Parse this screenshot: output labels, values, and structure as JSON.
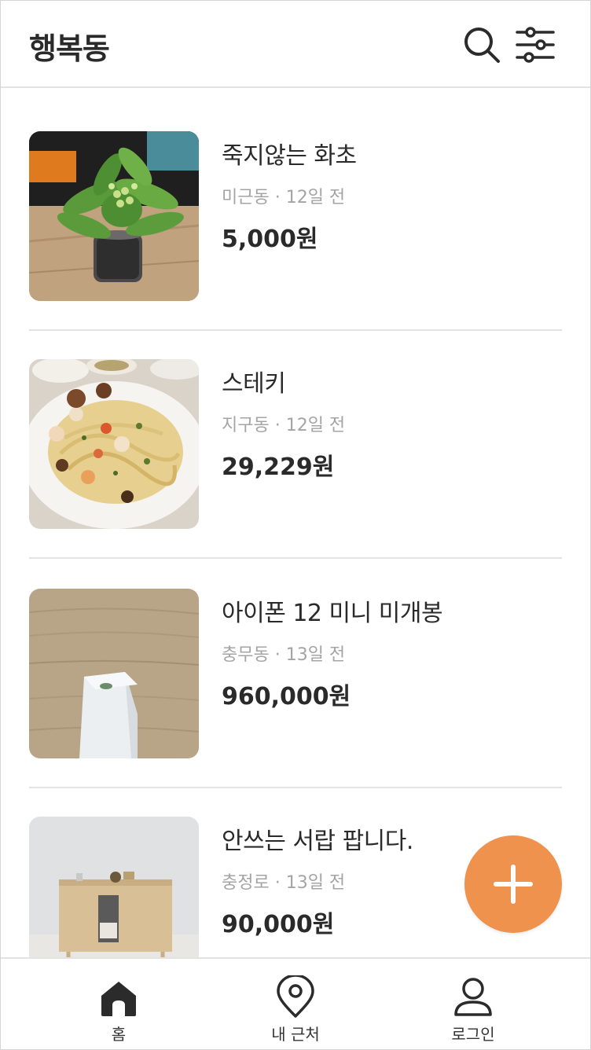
{
  "header": {
    "title": "행복동",
    "search_icon": "search-icon",
    "filter_icon": "sliders-icon"
  },
  "items": [
    {
      "title": "죽지않는 화초",
      "location": "미근동",
      "time": "12일 전",
      "meta": "미근동 · 12일 전",
      "price": "5,000원",
      "image": "plant-photo"
    },
    {
      "title": "스테키",
      "location": "지구동",
      "time": "12일 전",
      "meta": "지구동 · 12일 전",
      "price": "29,229원",
      "image": "pasta-photo"
    },
    {
      "title": "아이폰 12 미니 미개봉",
      "location": "충무동",
      "time": "13일 전",
      "meta": "충무동 · 13일 전",
      "price": "960,000원",
      "image": "box-photo"
    },
    {
      "title": "안쓰는 서랍 팝니다.",
      "location": "충정로",
      "time": "13일 전",
      "meta": "충정로 · 13일 전",
      "price": "90,000원",
      "image": "drawer-photo"
    }
  ],
  "fab": {
    "icon": "plus-icon",
    "color": "#ee924d"
  },
  "bottom_nav": [
    {
      "label": "홈",
      "icon": "home-icon",
      "active": true
    },
    {
      "label": "내 근처",
      "icon": "location-pin-icon",
      "active": false
    },
    {
      "label": "로그인",
      "icon": "user-icon",
      "active": false
    }
  ],
  "colors": {
    "accent": "#ee924d",
    "text": "#2a2a2a",
    "muted": "#a4a4a4",
    "divider": "#e3e3e3"
  }
}
